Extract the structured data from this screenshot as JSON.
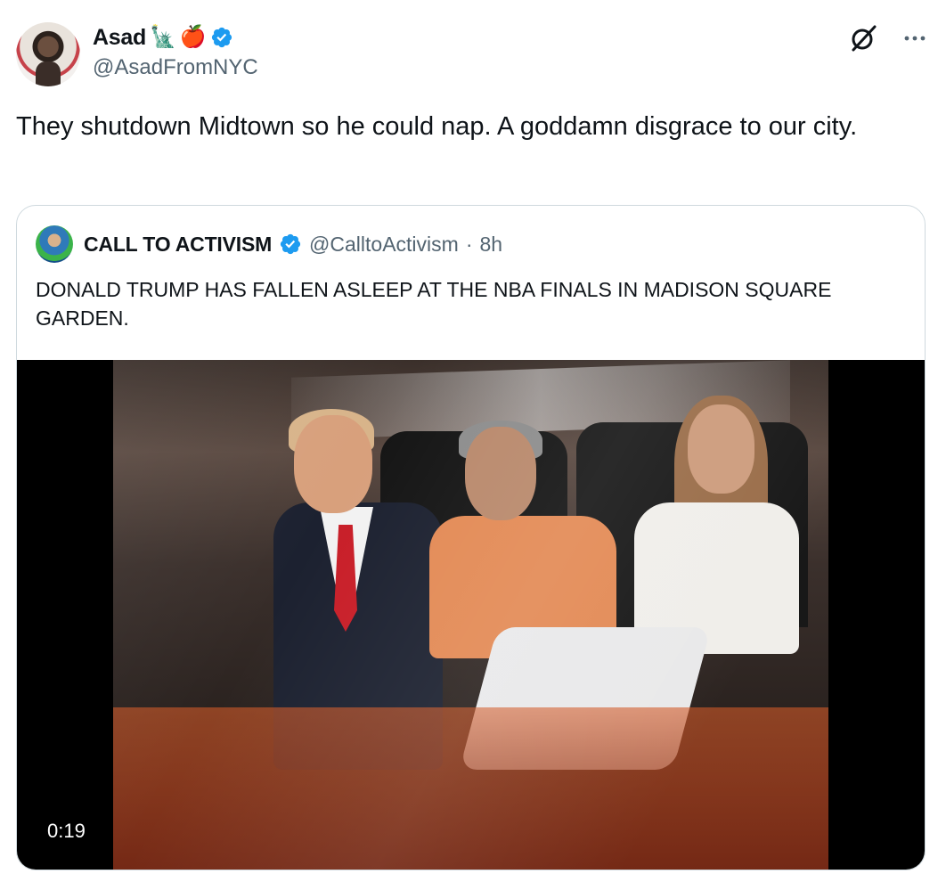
{
  "author": {
    "name": "Asad",
    "emojis": [
      "🗽",
      "🍎"
    ],
    "handle": "@AsadFromNYC",
    "verified": true
  },
  "tweet_text": "They shutdown Midtown so he could nap. A goddamn disgrace to our city.",
  "quoted": {
    "name": "CALL TO ACTIVISM",
    "handle": "@CalltoActivism",
    "separator": "·",
    "time": "8h",
    "verified": true,
    "text": "DONALD TRUMP HAS FALLEN ASLEEP AT THE NBA FINALS IN MADISON SQUARE GARDEN.",
    "video": {
      "duration": "0:19"
    }
  },
  "icons": {
    "grok": "grok-icon",
    "more": "more-icon",
    "verified": "verified-badge-icon"
  },
  "colors": {
    "verified": "#1d9bf0",
    "secondary_text": "#536471",
    "border": "#cfd9de"
  }
}
